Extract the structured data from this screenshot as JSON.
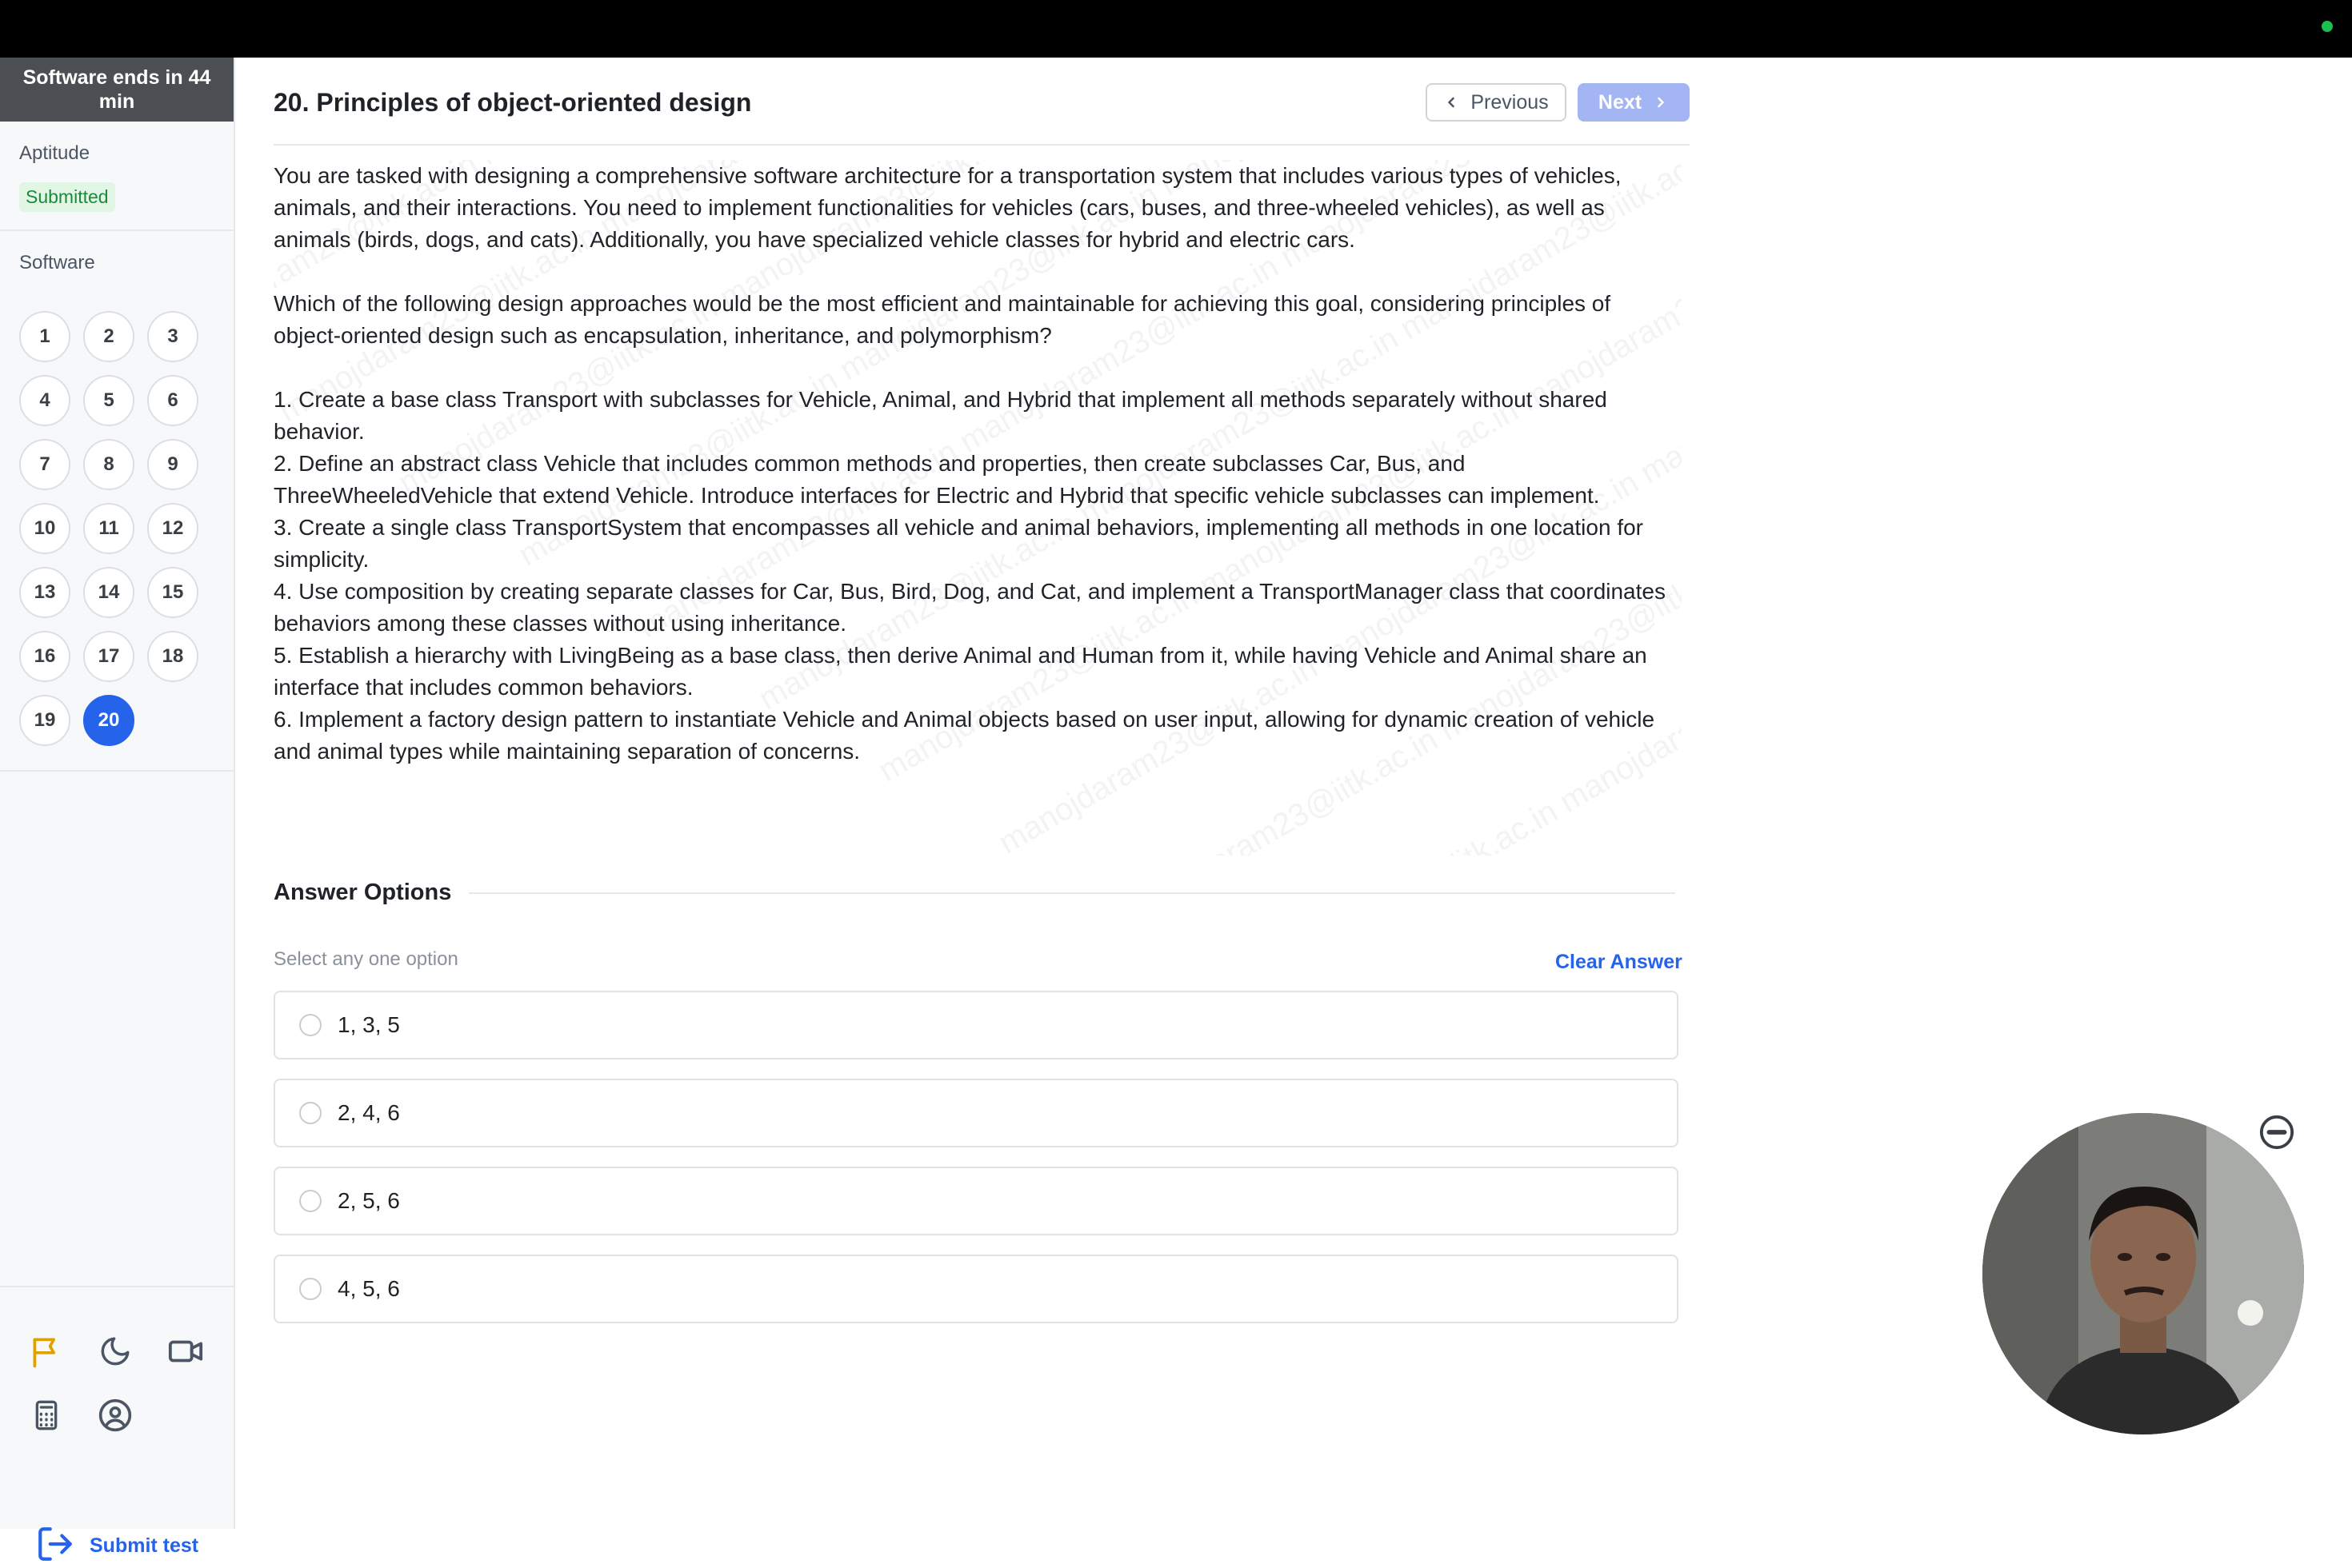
{
  "timer": "Software ends in 44 min",
  "sections": {
    "aptitude": {
      "title": "Aptitude",
      "status": "Submitted"
    },
    "software": {
      "title": "Software"
    }
  },
  "questions": [
    "1",
    "2",
    "3",
    "4",
    "5",
    "6",
    "7",
    "8",
    "9",
    "10",
    "11",
    "12",
    "13",
    "14",
    "15",
    "16",
    "17",
    "18",
    "19",
    "20"
  ],
  "current_question": "20",
  "header": {
    "title": "20. Principles of object-oriented design",
    "prev_label": "Previous",
    "next_label": "Next"
  },
  "watermark": "manojdaram23@iitk.ac.in",
  "question": {
    "para1": "You are tasked with designing a comprehensive software architecture for a transportation system that includes various types of vehicles, animals, and their interactions. You need to implement functionalities for vehicles (cars, buses, and three-wheeled vehicles), as well as animals (birds, dogs, and cats). Additionally, you have specialized vehicle classes for hybrid and electric cars.",
    "para2": "Which of the following design approaches would be the most efficient and maintainable for achieving this goal, considering principles of object-oriented design such as encapsulation, inheritance, and polymorphism?",
    "items": [
      "1. Create a base class Transport with subclasses for Vehicle, Animal, and Hybrid that implement all methods separately without shared behavior.",
      "2. Define an abstract class Vehicle that includes common methods and properties, then create subclasses Car, Bus, and ThreeWheeledVehicle that extend Vehicle. Introduce interfaces for Electric and Hybrid that specific vehicle subclasses can implement.",
      "3. Create a single class TransportSystem that encompasses all vehicle and animal behaviors, implementing all methods in one location for simplicity.",
      "4. Use composition by creating separate classes for Car, Bus, Bird, Dog, and Cat, and implement a TransportManager class that coordinates behaviors among these classes without using inheritance.",
      "5. Establish a hierarchy with LivingBeing as a base class, then derive Animal and Human from it, while having Vehicle and Animal share an interface that includes common behaviors.",
      "6. Implement a factory design pattern to instantiate Vehicle and Animal objects based on user input, allowing for dynamic creation of vehicle and animal types while maintaining separation of concerns."
    ]
  },
  "answers": {
    "title": "Answer Options",
    "hint": "Select any one option",
    "clear_label": "Clear Answer",
    "options": [
      "1, 3, 5",
      "2, 4, 6",
      "2, 5, 6",
      "4, 5, 6"
    ]
  },
  "footer": {
    "submit_label": "Submit test"
  },
  "colors": {
    "accent": "#2563eb",
    "submitted": "#1d8a3a",
    "flag": "#e0a100",
    "next_disabled": "#a3b6f3"
  }
}
